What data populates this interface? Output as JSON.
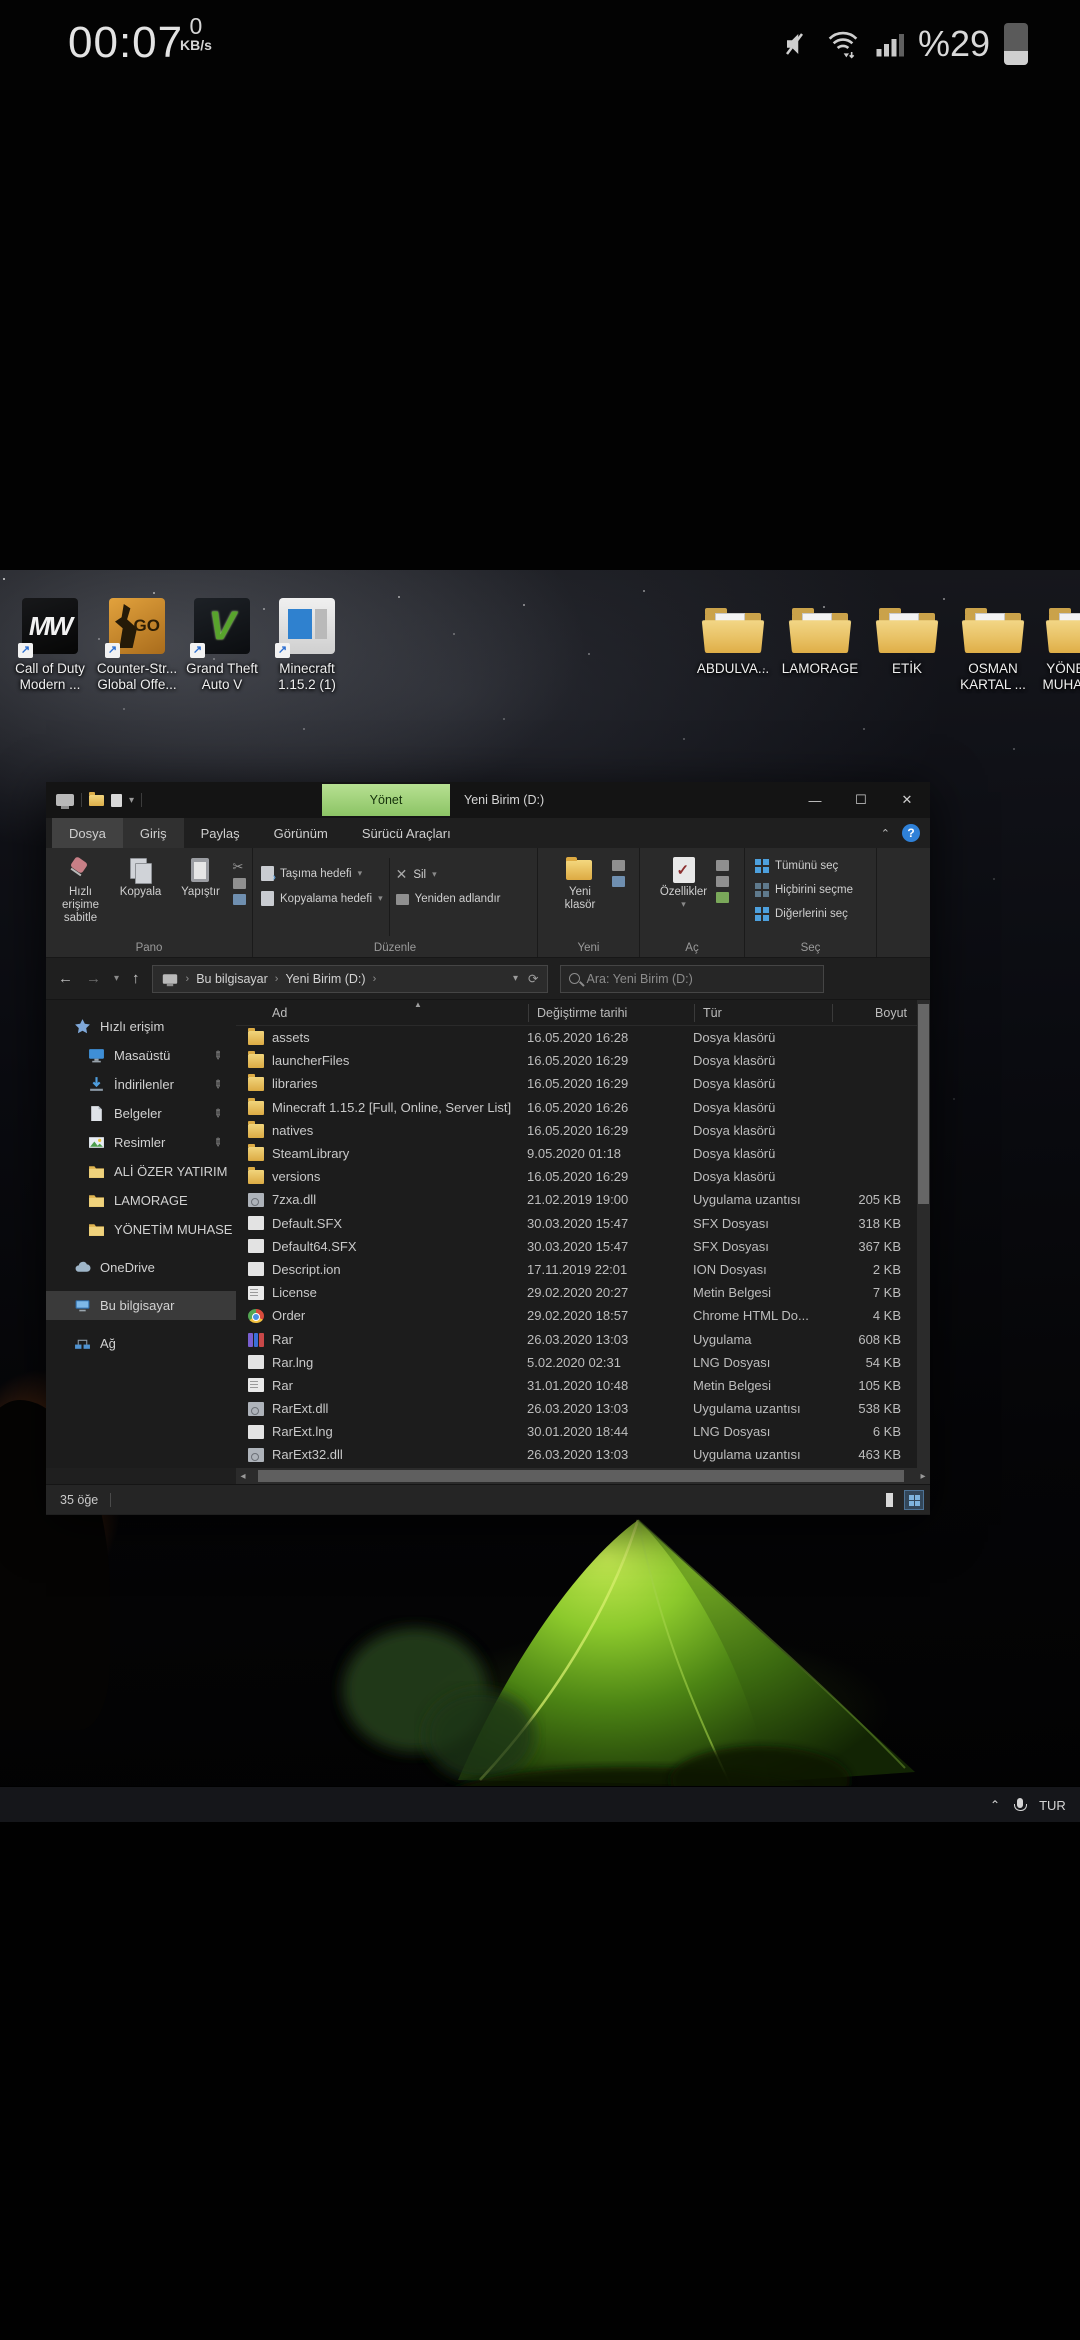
{
  "phone_status_bar": {
    "time": "00:07",
    "net_speed_value": "0",
    "net_speed_unit": "KB/s",
    "battery_percent": "%29"
  },
  "desktop": {
    "left_icons": [
      {
        "kind": "cod",
        "glyph": "MW",
        "label_line1": "Call of Duty",
        "label_line2": "Modern ..."
      },
      {
        "kind": "csgo",
        "glyph": "GO",
        "label_line1": "Counter-Str...",
        "label_line2": "Global Offe..."
      },
      {
        "kind": "gtav",
        "glyph": "V",
        "label_line1": "Grand Theft",
        "label_line2": "Auto V"
      },
      {
        "kind": "minecraft",
        "glyph": "",
        "label_line1": "Minecraft",
        "label_line2": "1.15.2 (1)"
      }
    ],
    "right_icons": [
      {
        "kind": "folder",
        "paper": "red",
        "label_line1": "ABDULVA...",
        "label_line2": ""
      },
      {
        "kind": "folder",
        "paper": "none",
        "label_line1": "LAMORAGE",
        "label_line2": ""
      },
      {
        "kind": "folder",
        "paper": "blue",
        "label_line1": "ETİK",
        "label_line2": ""
      },
      {
        "kind": "folder",
        "paper": "white",
        "label_line1": "OSMAN",
        "label_line2": "KARTAL ..."
      },
      {
        "kind": "folder",
        "paper": "red",
        "label_line1": "YÖNETİM",
        "label_line2": "MUHASE..."
      }
    ]
  },
  "explorer": {
    "window_title": "Yeni Birim (D:)",
    "contextual_tab": "Yönet",
    "menu_tabs": [
      {
        "label": "Dosya"
      },
      {
        "label": "Giriş"
      },
      {
        "label": "Paylaş"
      },
      {
        "label": "Görünüm"
      },
      {
        "label": "Sürücü Araçları"
      }
    ],
    "ribbon": {
      "pin_quick_access": "Hızlı erişime sabitle",
      "copy": "Kopyala",
      "paste": "Yapıştır",
      "move_to": "Taşıma hedefi",
      "copy_to": "Kopyalama hedefi",
      "delete": "Sil",
      "rename": "Yeniden adlandır",
      "new_folder_line1": "Yeni",
      "new_folder_line2": "klasör",
      "properties": "Özellikler",
      "select_all": "Tümünü seç",
      "select_none": "Hiçbirini seçme",
      "invert_selection": "Diğerlerini seç",
      "group_clipboard": "Pano",
      "group_organize": "Düzenle",
      "group_new": "Yeni",
      "group_open": "Aç",
      "group_select": "Seç"
    },
    "address_bar": {
      "crumb_root": "Bu bilgisayar",
      "crumb_current": "Yeni Birim (D:)",
      "search_placeholder": "Ara: Yeni Birim (D:)"
    },
    "sidebar": [
      {
        "icon": "star",
        "label": "Hızlı erişim",
        "pinned": false,
        "indent": false,
        "gap": false,
        "selected": false
      },
      {
        "icon": "desktop",
        "label": "Masaüstü",
        "pinned": true,
        "indent": true,
        "gap": false,
        "selected": false
      },
      {
        "icon": "download",
        "label": "İndirilenler",
        "pinned": true,
        "indent": true,
        "gap": false,
        "selected": false
      },
      {
        "icon": "document",
        "label": "Belgeler",
        "pinned": true,
        "indent": true,
        "gap": false,
        "selected": false
      },
      {
        "icon": "picture",
        "label": "Resimler",
        "pinned": true,
        "indent": true,
        "gap": false,
        "selected": false
      },
      {
        "icon": "folder",
        "label": "ALİ ÖZER YATIRIM",
        "pinned": false,
        "indent": true,
        "gap": false,
        "selected": false
      },
      {
        "icon": "folder",
        "label": "LAMORAGE",
        "pinned": false,
        "indent": true,
        "gap": false,
        "selected": false
      },
      {
        "icon": "folder",
        "label": "YÖNETİM MUHASE",
        "pinned": false,
        "indent": true,
        "gap": false,
        "selected": false
      },
      {
        "icon": "cloud",
        "label": "OneDrive",
        "pinned": false,
        "indent": false,
        "gap": true,
        "selected": false
      },
      {
        "icon": "computer",
        "label": "Bu bilgisayar",
        "pinned": false,
        "indent": false,
        "gap": true,
        "selected": true
      },
      {
        "icon": "network",
        "label": "Ağ",
        "pinned": false,
        "indent": false,
        "gap": true,
        "selected": false
      }
    ],
    "columns": [
      "Ad",
      "Değiştirme tarihi",
      "Tür",
      "Boyut"
    ],
    "files": [
      {
        "icon": "folder",
        "name": "assets",
        "date": "16.05.2020 16:28",
        "type": "Dosya klasörü",
        "size": ""
      },
      {
        "icon": "folder",
        "name": "launcherFiles",
        "date": "16.05.2020 16:29",
        "type": "Dosya klasörü",
        "size": ""
      },
      {
        "icon": "folder",
        "name": "libraries",
        "date": "16.05.2020 16:29",
        "type": "Dosya klasörü",
        "size": ""
      },
      {
        "icon": "folder",
        "name": "Minecraft 1.15.2 [Full, Online, Server List]",
        "date": "16.05.2020 16:26",
        "type": "Dosya klasörü",
        "size": ""
      },
      {
        "icon": "folder",
        "name": "natives",
        "date": "16.05.2020 16:29",
        "type": "Dosya klasörü",
        "size": ""
      },
      {
        "icon": "folder",
        "name": "SteamLibrary",
        "date": "9.05.2020 01:18",
        "type": "Dosya klasörü",
        "size": ""
      },
      {
        "icon": "folder",
        "name": "versions",
        "date": "16.05.2020 16:29",
        "type": "Dosya klasörü",
        "size": ""
      },
      {
        "icon": "dll",
        "name": "7zxa.dll",
        "date": "21.02.2019 19:00",
        "type": "Uygulama uzantısı",
        "size": "205 KB"
      },
      {
        "icon": "page",
        "name": "Default.SFX",
        "date": "30.03.2020 15:47",
        "type": "SFX Dosyası",
        "size": "318 KB"
      },
      {
        "icon": "page",
        "name": "Default64.SFX",
        "date": "30.03.2020 15:47",
        "type": "SFX Dosyası",
        "size": "367 KB"
      },
      {
        "icon": "page",
        "name": "Descript.ion",
        "date": "17.11.2019 22:01",
        "type": "ION Dosyası",
        "size": "2 KB"
      },
      {
        "icon": "text",
        "name": "License",
        "date": "29.02.2020 20:27",
        "type": "Metin Belgesi",
        "size": "7 KB"
      },
      {
        "icon": "chrome",
        "name": "Order",
        "date": "29.02.2020 18:57",
        "type": "Chrome HTML Do...",
        "size": "4 KB"
      },
      {
        "icon": "rar",
        "name": "Rar",
        "date": "26.03.2020 13:03",
        "type": "Uygulama",
        "size": "608 KB"
      },
      {
        "icon": "page",
        "name": "Rar.lng",
        "date": "5.02.2020 02:31",
        "type": "LNG Dosyası",
        "size": "54 KB"
      },
      {
        "icon": "text",
        "name": "Rar",
        "date": "31.01.2020 10:48",
        "type": "Metin Belgesi",
        "size": "105 KB"
      },
      {
        "icon": "dll",
        "name": "RarExt.dll",
        "date": "26.03.2020 13:03",
        "type": "Uygulama uzantısı",
        "size": "538 KB"
      },
      {
        "icon": "page",
        "name": "RarExt.lng",
        "date": "30.01.2020 18:44",
        "type": "LNG Dosyası",
        "size": "6 KB"
      },
      {
        "icon": "dll",
        "name": "RarExt32.dll",
        "date": "26.03.2020 13:03",
        "type": "Uygulama uzantısı",
        "size": "463 KB"
      }
    ],
    "status_bar": {
      "item_count": "35 öğe"
    }
  },
  "taskbar": {
    "language": "TUR"
  },
  "colors": {
    "manage_tab_green": "#9ccf7a",
    "folder_yellow": "#e8c561",
    "help_blue": "#2f81d8",
    "selection_gray": "#3a3a3a"
  }
}
